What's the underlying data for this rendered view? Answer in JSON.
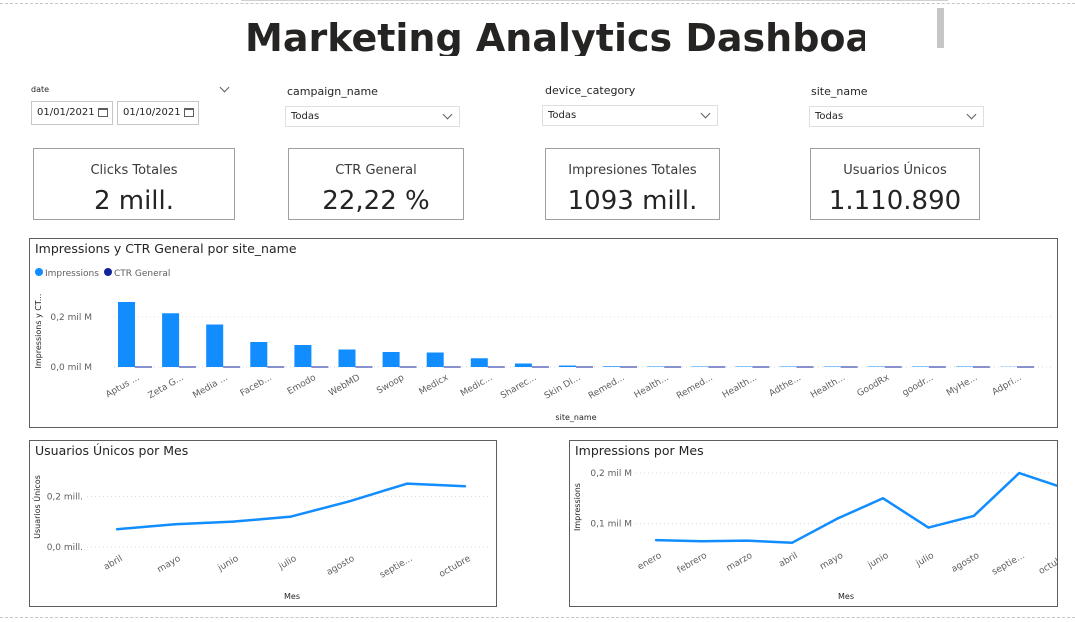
{
  "dashboard": {
    "title": "Marketing Analytics Dashboard"
  },
  "filters": {
    "date": {
      "label": "date",
      "start": "01/01/2021",
      "end": "01/10/2021"
    },
    "campaign": {
      "label": "campaign_name",
      "selected": "Todas"
    },
    "device": {
      "label": "device_category",
      "selected": "Todas"
    },
    "site": {
      "label": "site_name",
      "selected": "Todas"
    }
  },
  "cards": [
    {
      "label": "Clicks Totales",
      "value": "2 mill."
    },
    {
      "label": "CTR General",
      "value": "22,22 %"
    },
    {
      "label": "Impresiones Totales",
      "value": "1093 mill."
    },
    {
      "label": "Usuarios Únicos",
      "value": "1.110.890"
    }
  ],
  "colors": {
    "impressions": "#118dff",
    "ctr": "#12239e",
    "grid": "#d9d9d9"
  },
  "chart_data": [
    {
      "type": "bar",
      "title": "Impressions y CTR General por site_name",
      "xlabel": "site_name",
      "ylabel": "Impressions y CT...",
      "legend": [
        "Impressions",
        "CTR General"
      ],
      "legend_position": "top-left",
      "yticks": [
        "0,0 mil M",
        "0,2 mil M"
      ],
      "ytick_values": [
        0,
        0.2
      ],
      "ylim": [
        0,
        0.3
      ],
      "categories": [
        "Aptus ...",
        "Zeta G...",
        "Media ...",
        "Faceb...",
        "Emodo",
        "WebMD",
        "Swoop",
        "Medicx",
        "Medic...",
        "Sharec...",
        "Skin Di...",
        "Remed...",
        "Health...",
        "Remed...",
        "Health...",
        "Adthe...",
        "Health...",
        "GoodRx",
        "goodr...",
        "MyHe...",
        "Adpri..."
      ],
      "series": [
        {
          "name": "Impressions",
          "values": [
            0.26,
            0.215,
            0.17,
            0.1,
            0.088,
            0.07,
            0.06,
            0.058,
            0.035,
            0.014,
            0.006,
            0.003,
            0.002,
            0.002,
            0.002,
            0.002,
            0.002,
            0.002,
            0.002,
            0.002,
            0.001
          ]
        },
        {
          "name": "CTR General",
          "values": [
            0.002,
            0.002,
            0.002,
            0.002,
            0.002,
            0.002,
            0.002,
            0.002,
            0.002,
            0.002,
            0.002,
            0.002,
            0.002,
            0.002,
            0.002,
            0.002,
            0.002,
            0.002,
            0.002,
            0.002,
            0.002
          ]
        }
      ]
    },
    {
      "type": "line",
      "title": "Usuarios Únicos por Mes",
      "xlabel": "Mes",
      "ylabel": "Usuarios Únicos",
      "yticks": [
        "0,0 mill.",
        "0,2 mill."
      ],
      "ytick_values": [
        0,
        0.2
      ],
      "ylim": [
        0,
        0.3
      ],
      "categories": [
        "abril",
        "mayo",
        "junio",
        "julio",
        "agosto",
        "septie...",
        "octubre"
      ],
      "series": [
        {
          "values": [
            0.07,
            0.09,
            0.1,
            0.12,
            0.18,
            0.25,
            0.24
          ]
        }
      ]
    },
    {
      "type": "line",
      "title": "Impressions por Mes",
      "xlabel": "Mes",
      "ylabel": "Impressions",
      "yticks": [
        "0,1 mil M",
        "0,2 mil M"
      ],
      "ytick_values": [
        0.1,
        0.2
      ],
      "ylim": [
        0,
        0.21
      ],
      "categories": [
        "enero",
        "febrero",
        "marzo",
        "abril",
        "mayo",
        "junio",
        "julio",
        "agosto",
        "septie...",
        "octubre"
      ],
      "series": [
        {
          "values": [
            0.067,
            0.065,
            0.066,
            0.062,
            0.11,
            0.15,
            0.092,
            0.115,
            0.2,
            0.17
          ]
        }
      ]
    }
  ]
}
